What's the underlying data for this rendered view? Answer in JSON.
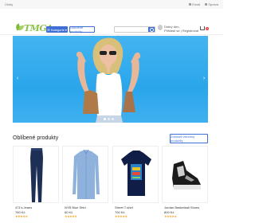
{
  "topbar": {
    "left_text": "Účety",
    "right_links": [
      {
        "label": "Email",
        "icon": "mail-icon"
      },
      {
        "label": "Správa",
        "icon": "settings-icon"
      }
    ]
  },
  "header": {
    "logo_text": "TMGA",
    "categories_label": "Kategorie",
    "favorites_label": "Oblíbené produkty",
    "search_placeholder": "Hledat",
    "user_line1": "Dobrý den,",
    "user_line2": "Přihlásit se | Registrovat",
    "cart_count": "0"
  },
  "banner": {
    "slide_count": 3,
    "active_slide": 1
  },
  "section": {
    "title": "Oblíbené produkty",
    "all_button_label": "Zobrazit všechny produkty"
  },
  "products": [
    {
      "name": "471's Jeans",
      "price": "760 Kč",
      "stars": "★★★★★",
      "image": "jeans"
    },
    {
      "name": "NYB Blue Shirt",
      "price": "60 Kč",
      "stars": "★★★★★",
      "image": "shirt"
    },
    {
      "name": "Street T-shirt",
      "price": "700 Kč",
      "stars": "★★★★★",
      "image": "tshirt"
    },
    {
      "name": "Jordan Basketball Shoes",
      "price": "800 Kč",
      "stars": "★★★★★",
      "image": "shoes"
    }
  ],
  "colors": {
    "accent": "#3f6fd6",
    "banner_bg": "#2aa6ec",
    "logo_green": "#8bc34a",
    "star": "#f5a623"
  }
}
